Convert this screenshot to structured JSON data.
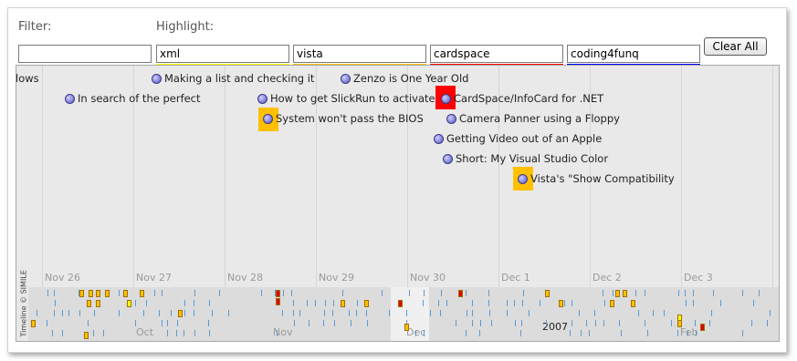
{
  "filter": {
    "label": "Filter:",
    "value": ""
  },
  "highlight": {
    "label": "Highlight:",
    "fields": [
      {
        "value": "xml",
        "color": "#ffff00"
      },
      {
        "value": "vista",
        "color": "#ffc000"
      },
      {
        "value": "cardspace",
        "color": "#ff0000"
      },
      {
        "value": "coding4funq",
        "color": "#0000ff"
      }
    ]
  },
  "clear_all_label": "Clear All",
  "timeline": {
    "date_labels": [
      "Nov 26",
      "Nov 27",
      "Nov 28",
      "Nov 29",
      "Nov 30",
      "Dec 1",
      "Dec 2",
      "Dec 3"
    ],
    "events": [
      {
        "text": "lows"
      },
      {
        "text": "Making a list and checking it"
      },
      {
        "text": "Zenzo is One Year Old"
      },
      {
        "text": "In search of the perfect"
      },
      {
        "text": "How to get SlickRun to activate"
      },
      {
        "text": "CardSpace/InfoCard for .NET"
      },
      {
        "text": "System won't pass the BIOS"
      },
      {
        "text": "Camera Panner using a Floppy"
      },
      {
        "text": "Getting Video out of an Apple"
      },
      {
        "text": "Short: My Visual Studio Color"
      },
      {
        "text": "Vista's \"Show Compatibility"
      }
    ],
    "overview": {
      "months": [
        "Oct",
        "Nov",
        "Dec",
        "Feb"
      ],
      "year": "2007"
    },
    "credit": "Timeline © SIMILE"
  }
}
